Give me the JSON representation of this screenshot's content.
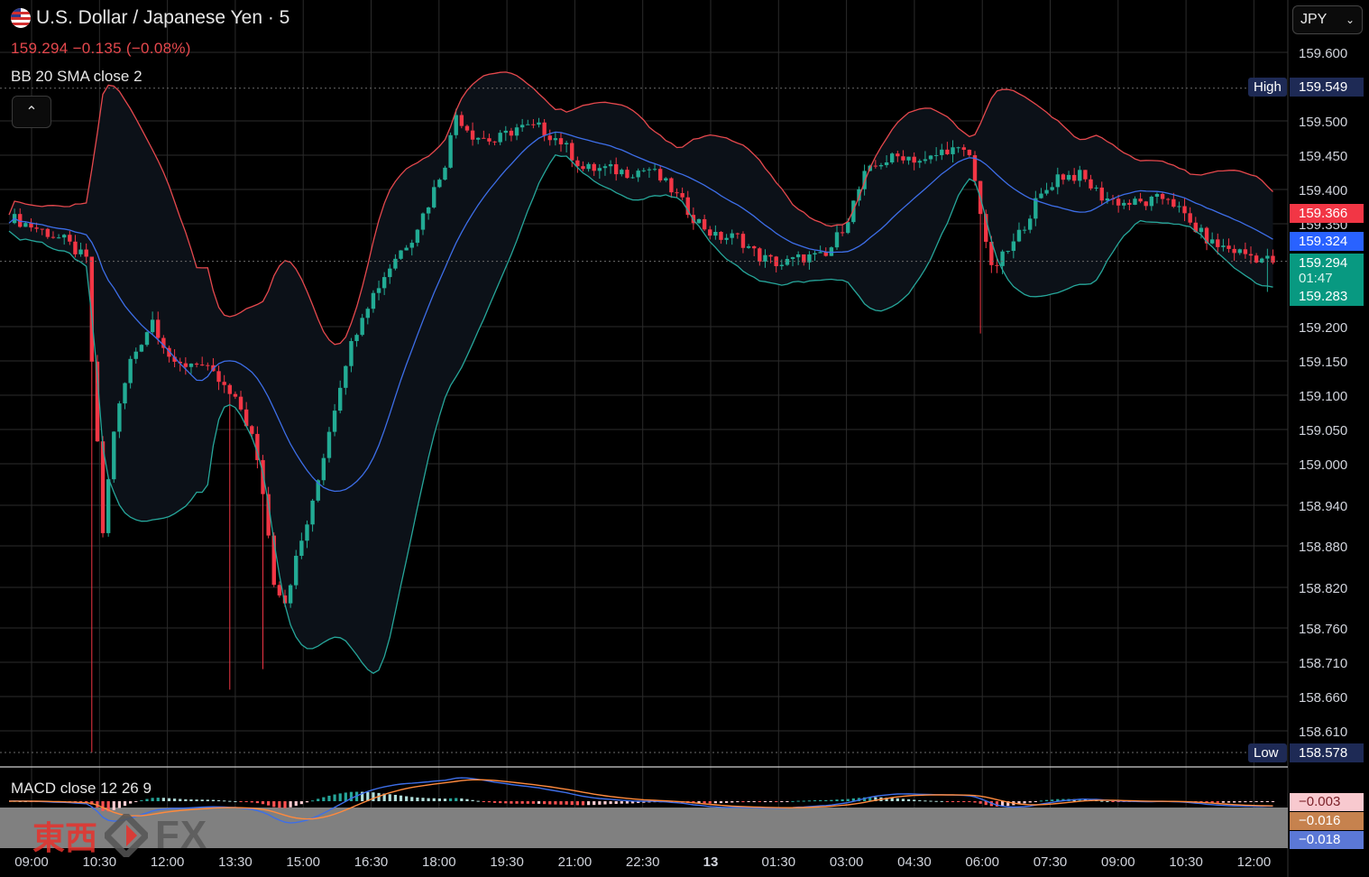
{
  "header": {
    "title": "U.S. Dollar / Japanese Yen · 5",
    "quote": "159.294  −0.135 (−0.08%)",
    "bb_label": "BB 20 SMA close 2",
    "macd_label": "MACD close 12 26 9"
  },
  "currency_select": {
    "value": "JPY"
  },
  "watermark": {
    "kanji": "東西",
    "fx": "FX"
  },
  "colors": {
    "background": "#000000",
    "grid": "#2b2b2b",
    "candle_up": "#22ab94",
    "candle_down": "#f23645",
    "bb_upper": "#e5484d",
    "bb_lower": "#26a69a",
    "bb_basis": "#3d6ee8",
    "bb_fill": "#0c1118",
    "macd_line": "#3d6ee8",
    "signal_line": "#ff8a3d",
    "macd_panel": "#808080"
  },
  "price_tags": [
    {
      "kind": "label",
      "text": "High",
      "value": "159.549",
      "bg": "#1e2a55",
      "fg": "#ffffff"
    },
    {
      "kind": "price",
      "value": "159.366",
      "bg": "#f23645",
      "fg": "#ffffff"
    },
    {
      "kind": "price",
      "value": "159.324",
      "bg": "#2962ff",
      "fg": "#ffffff"
    },
    {
      "kind": "price",
      "value": "159.294",
      "bg": "#089981",
      "fg": "#ffffff"
    },
    {
      "kind": "price",
      "value": "01:47",
      "bg": "#089981",
      "fg": "#d8f3ec"
    },
    {
      "kind": "price",
      "value": "159.283",
      "bg": "#089981",
      "fg": "#ffffff"
    },
    {
      "kind": "label",
      "text": "Low",
      "value": "158.578",
      "bg": "#1e2a55",
      "fg": "#ffffff"
    },
    {
      "kind": "macd",
      "value": "−0.003",
      "bg": "#f8c9cf",
      "fg": "#7a1f27"
    },
    {
      "kind": "macd",
      "value": "−0.016",
      "bg": "#c6824e",
      "fg": "#ffffff"
    },
    {
      "kind": "macd",
      "value": "−0.018",
      "bg": "#5b78d6",
      "fg": "#ffffff"
    }
  ],
  "chart_data": {
    "type": "candlestick",
    "symbol": "U.S. Dollar / Japanese Yen",
    "interval": "5",
    "y_axis_ticks": [
      "159.600",
      "159.500",
      "159.450",
      "159.400",
      "159.350",
      "159.200",
      "159.150",
      "159.100",
      "159.050",
      "159.000",
      "158.940",
      "158.880",
      "158.820",
      "158.760",
      "158.710",
      "158.660",
      "158.610"
    ],
    "x_axis_ticks": [
      "09:00",
      "10:30",
      "12:00",
      "13:30",
      "15:00",
      "16:30",
      "18:00",
      "19:30",
      "21:00",
      "22:30",
      "13",
      "01:30",
      "03:00",
      "04:30",
      "06:00",
      "07:30",
      "09:00",
      "10:30",
      "12:00"
    ],
    "last_price": 159.294,
    "change": -0.135,
    "change_pct": -0.08,
    "session_high": 159.549,
    "session_low": 158.578,
    "bb_upper_last": 159.366,
    "bb_basis_last": 159.324,
    "low_of_last_bar": 159.283,
    "close_path": [
      [
        0,
        159.36
      ],
      [
        6,
        159.34
      ],
      [
        10,
        159.325
      ],
      [
        14,
        159.295
      ],
      [
        15,
        159.15
      ],
      [
        17,
        158.9
      ],
      [
        19,
        159.05
      ],
      [
        22,
        159.15
      ],
      [
        26,
        159.21
      ],
      [
        30,
        159.14
      ],
      [
        34,
        159.15
      ],
      [
        38,
        159.12
      ],
      [
        42,
        159.08
      ],
      [
        44,
        159.04
      ],
      [
        46,
        158.96
      ],
      [
        48,
        158.83
      ],
      [
        50,
        158.8
      ],
      [
        52,
        158.86
      ],
      [
        55,
        158.94
      ],
      [
        58,
        159.05
      ],
      [
        61,
        159.15
      ],
      [
        64,
        159.22
      ],
      [
        67,
        159.26
      ],
      [
        70,
        159.3
      ],
      [
        73,
        159.33
      ],
      [
        76,
        159.38
      ],
      [
        79,
        159.44
      ],
      [
        81,
        159.51
      ],
      [
        84,
        159.48
      ],
      [
        88,
        159.47
      ],
      [
        92,
        159.49
      ],
      [
        96,
        159.49
      ],
      [
        100,
        159.47
      ],
      [
        104,
        159.43
      ],
      [
        108,
        159.43
      ],
      [
        112,
        159.425
      ],
      [
        116,
        159.43
      ],
      [
        120,
        159.4
      ],
      [
        124,
        159.36
      ],
      [
        128,
        159.33
      ],
      [
        132,
        159.33
      ],
      [
        136,
        159.3
      ],
      [
        140,
        159.29
      ],
      [
        144,
        159.3
      ],
      [
        148,
        159.3
      ],
      [
        152,
        159.36
      ],
      [
        155,
        159.42
      ],
      [
        158,
        159.44
      ],
      [
        162,
        159.45
      ],
      [
        166,
        159.44
      ],
      [
        170,
        159.46
      ],
      [
        174,
        159.45
      ],
      [
        176,
        159.37
      ],
      [
        178,
        159.28
      ],
      [
        182,
        159.32
      ],
      [
        186,
        159.38
      ],
      [
        190,
        159.42
      ],
      [
        194,
        159.42
      ],
      [
        198,
        159.39
      ],
      [
        202,
        159.38
      ],
      [
        206,
        159.38
      ],
      [
        210,
        159.39
      ],
      [
        214,
        159.35
      ],
      [
        218,
        159.32
      ],
      [
        222,
        159.31
      ],
      [
        226,
        159.3
      ],
      [
        229,
        159.294
      ]
    ],
    "macd_panel": {
      "macd": -0.018,
      "signal": -0.016,
      "histogram": -0.003
    }
  }
}
